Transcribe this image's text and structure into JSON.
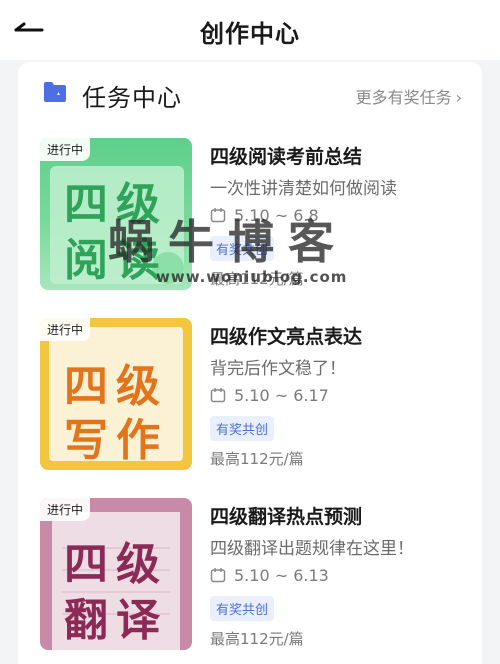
{
  "header": {
    "title": "创作中心"
  },
  "section": {
    "title": "任务中心",
    "more_label": "更多有奖任务"
  },
  "tasks": [
    {
      "badge": "进行中",
      "thumb_line1": "四级",
      "thumb_line2": "阅读",
      "title": "四级阅读考前总结",
      "desc": "一次性讲清楚如何做阅读",
      "date": "5.10 ~ 6.8",
      "tag": "有奖共创",
      "reward": "最高112元/篇"
    },
    {
      "badge": "进行中",
      "thumb_line1": "四级",
      "thumb_line2": "写作",
      "title": "四级作文亮点表达",
      "desc": "背完后作文稳了！",
      "date": "5.10 ~ 6.17",
      "tag": "有奖共创",
      "reward": "最高112元/篇"
    },
    {
      "badge": "进行中",
      "thumb_line1": "四级",
      "thumb_line2": "翻译",
      "title": "四级翻译热点预测",
      "desc": "四级翻译出题规律在这里！",
      "date": "5.10 ~ 6.13",
      "tag": "有奖共创",
      "reward": "最高112元/篇"
    }
  ],
  "watermark": {
    "main": "蜗牛博客",
    "sub": "www.woniublog.com"
  },
  "colors": {
    "accent": "#4a6fd8",
    "thumb_green": "#4cbf7a",
    "thumb_yellow": "#f3c33a",
    "thumb_pink": "#c98aa8"
  },
  "icons": [
    "back-arrow-icon",
    "folder-icon",
    "chevron-right-icon",
    "calendar-icon"
  ]
}
